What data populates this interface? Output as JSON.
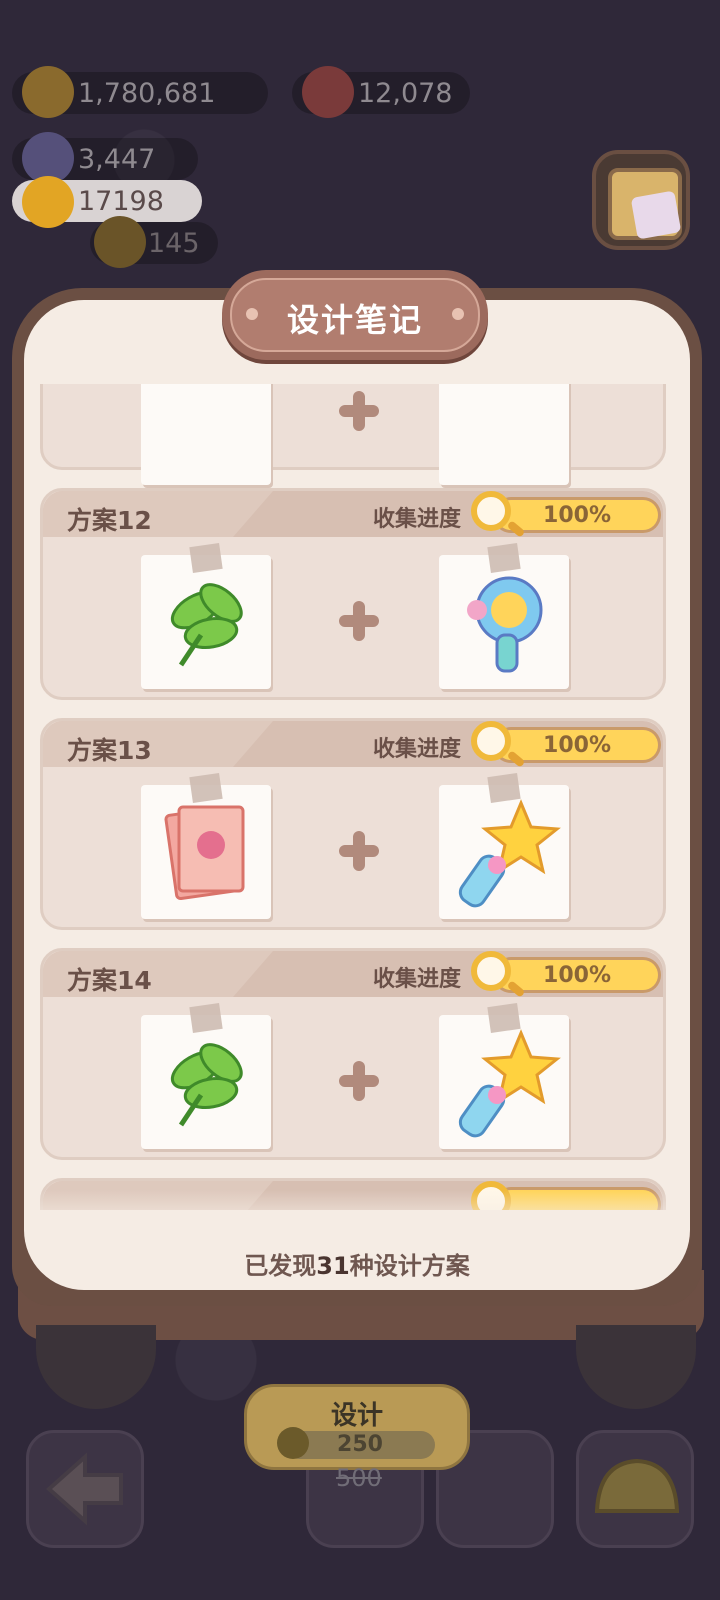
{
  "currencies": {
    "coins": "1,780,681",
    "gems": "12,078",
    "crystals": "3,447",
    "sunflowers": "17198",
    "extra": "145"
  },
  "dialog": {
    "title": "设计笔记",
    "progress_label": "收集进度",
    "summary_prefix": "已发现",
    "summary_count": "31",
    "summary_suffix": "种设计方案",
    "plans": [
      {
        "name": "方案12",
        "progress": "100%",
        "progress_value": 1.0,
        "item_a": "leaf-bundle-icon",
        "item_b": "toy-hair-dryer-icon"
      },
      {
        "name": "方案13",
        "progress": "100%",
        "progress_value": 1.0,
        "item_a": "poster-cards-icon",
        "item_b": "star-wand-icon"
      },
      {
        "name": "方案14",
        "progress": "100%",
        "progress_value": 1.0,
        "item_a": "leaf-bundle-icon",
        "item_b": "star-wand-icon"
      }
    ]
  },
  "bottom": {
    "design_label": "设计",
    "cost": "250",
    "old_cost": "500"
  },
  "colors": {
    "accent": "#ffd45a",
    "frame": "#6b4f43",
    "paper": "#f5ece4"
  }
}
